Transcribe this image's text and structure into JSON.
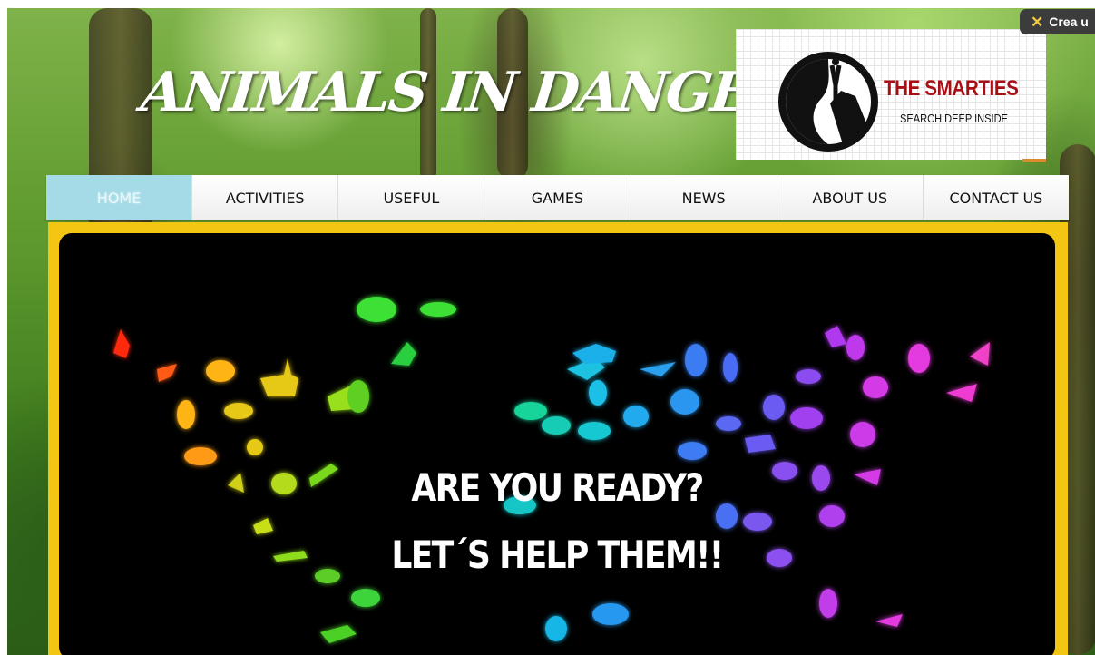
{
  "site": {
    "title": "ANIMALS IN DANGER",
    "logo_name": "THE SMARTIES",
    "logo_tagline": "SEARCH DEEP INSIDE"
  },
  "badge": {
    "label": "Crea u",
    "icon": "x-icon"
  },
  "nav": {
    "items": [
      {
        "label": "HOME",
        "active": true
      },
      {
        "label": "ACTIVITIES",
        "active": false
      },
      {
        "label": "USEFUL",
        "active": false
      },
      {
        "label": "GAMES",
        "active": false
      },
      {
        "label": "NEWS",
        "active": false
      },
      {
        "label": "ABOUT US",
        "active": false
      },
      {
        "label": "CONTACT US",
        "active": false
      }
    ]
  },
  "banner": {
    "line1": "ARE YOU READY?",
    "line2": "LET´S HELP THEM!!"
  },
  "colors": {
    "nav_active": "#a5dbe6",
    "frame": "#f2c613",
    "logo_red": "#a80f14",
    "banner_bg": "#000000"
  }
}
